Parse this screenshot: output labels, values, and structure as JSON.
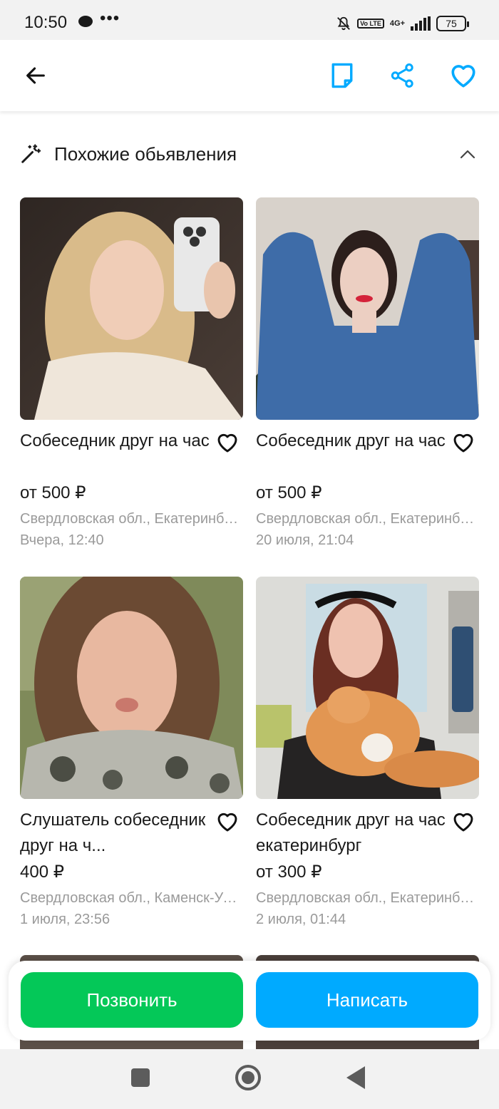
{
  "status_bar": {
    "time": "10:50",
    "dots": "•••",
    "volte": "Vo LTE",
    "network": "4G+",
    "battery": "75"
  },
  "app_bar": {
    "icons": [
      "back-arrow-icon",
      "note-icon",
      "share-icon",
      "heart-icon"
    ],
    "accent_color": "#00aaff"
  },
  "section": {
    "title": "Похожие обьявления",
    "icon": "magic-wand-icon"
  },
  "listings": [
    {
      "title": "Собеседник друг на час",
      "price": "от 500 ₽",
      "location": "Свердловская обл., Екатеринбург",
      "date": "Вчера, 12:40"
    },
    {
      "title": "Собеседник друг на час",
      "price": "от 500 ₽",
      "location": "Свердловская обл., Екатеринбург",
      "date": "20 июля, 21:04"
    },
    {
      "title": "Слушатель собеседник друг на ч...",
      "price": "400 ₽",
      "location": "Свердловская обл., Каменск-Уральский",
      "date": "1 июля, 23:56"
    },
    {
      "title": "Собеседник друг на час екатеринбург",
      "price": "от 300 ₽",
      "location": "Свердловская обл., Екатеринбург",
      "date": "2 июля, 01:44"
    }
  ],
  "actions": {
    "call_label": "Позвонить",
    "write_label": "Написать",
    "call_color": "#04c858",
    "write_color": "#00aaff"
  }
}
